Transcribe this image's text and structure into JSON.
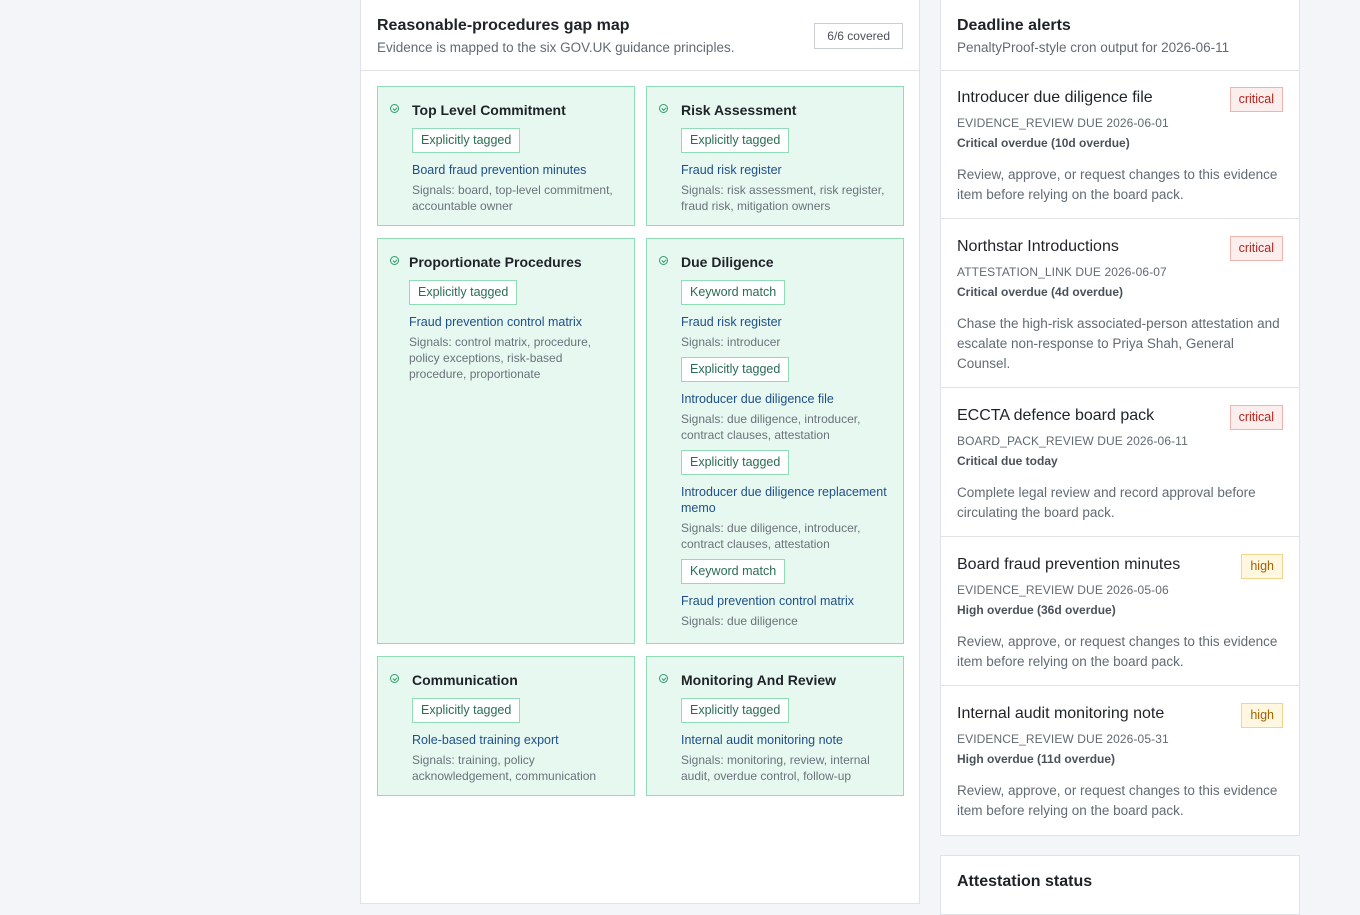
{
  "gap_map": {
    "title": "Reasonable-procedures gap map",
    "subtitle": "Evidence is mapped to the six GOV.UK guidance principles.",
    "coverage": "6/6 covered",
    "principles": [
      {
        "title": "Top Level Commitment",
        "evidence": [
          {
            "tag": "Explicitly tagged",
            "link": "Board fraud prevention minutes",
            "signals": "Signals: board, top-level commitment, accountable owner"
          }
        ]
      },
      {
        "title": "Risk Assessment",
        "evidence": [
          {
            "tag": "Explicitly tagged",
            "link": "Fraud risk register",
            "signals": "Signals: risk assessment, risk register, fraud risk, mitigation owners"
          }
        ]
      },
      {
        "title": "Proportionate Procedures",
        "evidence": [
          {
            "tag": "Explicitly tagged",
            "link": "Fraud prevention control matrix",
            "signals": "Signals: control matrix, procedure, policy exceptions, risk-based procedure, proportionate"
          }
        ]
      },
      {
        "title": "Due Diligence",
        "evidence": [
          {
            "tag": "Keyword match",
            "link": "Fraud risk register",
            "signals": "Signals: introducer"
          },
          {
            "tag": "Explicitly tagged",
            "link": "Introducer due diligence file",
            "signals": "Signals: due diligence, introducer, contract clauses, attestation"
          },
          {
            "tag": "Explicitly tagged",
            "link": "Introducer due diligence replacement memo",
            "signals": "Signals: due diligence, introducer, contract clauses, attestation"
          },
          {
            "tag": "Keyword match",
            "link": "Fraud prevention control matrix",
            "signals": "Signals: due diligence"
          }
        ]
      },
      {
        "title": "Communication",
        "evidence": [
          {
            "tag": "Explicitly tagged",
            "link": "Role-based training export",
            "signals": "Signals: training, policy acknowledgement, communication"
          }
        ]
      },
      {
        "title": "Monitoring And Review",
        "evidence": [
          {
            "tag": "Explicitly tagged",
            "link": "Internal audit monitoring note",
            "signals": "Signals: monitoring, review, internal audit, overdue control, follow-up"
          }
        ]
      }
    ]
  },
  "alerts": {
    "title": "Deadline alerts",
    "subtitle": "PenaltyProof-style cron output for 2026-06-11",
    "items": [
      {
        "title": "Introducer due diligence file",
        "severity": "critical",
        "code": "EVIDENCE_REVIEW DUE 2026-06-01",
        "status": "Critical overdue (10d overdue)",
        "desc": "Review, approve, or request changes to this evidence item before relying on the board pack."
      },
      {
        "title": "Northstar Introductions",
        "severity": "critical",
        "code": "ATTESTATION_LINK DUE 2026-06-07",
        "status": "Critical overdue (4d overdue)",
        "desc": "Chase the high-risk associated-person attestation and escalate non-response to Priya Shah, General Counsel."
      },
      {
        "title": "ECCTA defence board pack",
        "severity": "critical",
        "code": "BOARD_PACK_REVIEW DUE 2026-06-11",
        "status": "Critical due today",
        "desc": "Complete legal review and record approval before circulating the board pack."
      },
      {
        "title": "Board fraud prevention minutes",
        "severity": "high",
        "code": "EVIDENCE_REVIEW DUE 2026-05-06",
        "status": "High overdue (36d overdue)",
        "desc": "Review, approve, or request changes to this evidence item before relying on the board pack."
      },
      {
        "title": "Internal audit monitoring note",
        "severity": "high",
        "code": "EVIDENCE_REVIEW DUE 2026-05-31",
        "status": "High overdue (11d overdue)",
        "desc": "Review, approve, or request changes to this evidence item before relying on the board pack."
      }
    ]
  },
  "attestation": {
    "title": "Attestation status"
  }
}
